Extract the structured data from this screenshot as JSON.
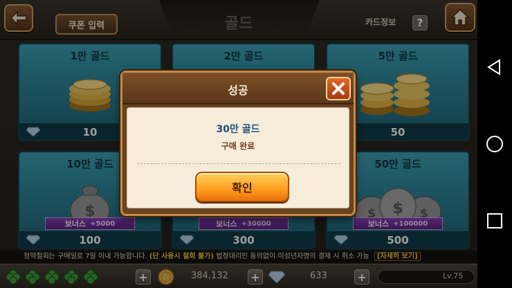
{
  "header": {
    "title": "골드",
    "coupon_button": "쿠폰 입력",
    "card_info_label": "카드정보",
    "help_symbol": "?"
  },
  "products": [
    {
      "title": "1만 골드",
      "price": "10",
      "bonus_label": "",
      "bonus_amount": "",
      "art": "coin-stack-small"
    },
    {
      "title": "2만 골드",
      "price": "",
      "bonus_label": "",
      "bonus_amount": "",
      "art": "coin-stack-medium"
    },
    {
      "title": "5만 골드",
      "price": "50",
      "bonus_label": "",
      "bonus_amount": "",
      "art": "coin-stack-large"
    },
    {
      "title": "10만 골드",
      "price": "100",
      "bonus_label": "보너스",
      "bonus_amount": "+5000",
      "art": "money-bag"
    },
    {
      "title": "",
      "price": "300",
      "bonus_label": "보너스",
      "bonus_amount": "+30000",
      "art": "money-bags"
    },
    {
      "title": "50만 골드",
      "price": "500",
      "bonus_label": "보너스",
      "bonus_amount": "+100000",
      "art": "money-bags-large"
    }
  ],
  "dialog": {
    "title": "성공",
    "item": "30만 골드",
    "message": "구매 완료",
    "confirm_button": "확인"
  },
  "notice": {
    "text_before": "청약철회는 구매일로 7일 이내 가능합니다.",
    "warning": "(단 사용시 철회 불가)",
    "text_after": "법정대리인 동의없이 미성년자명의 결제 시 취소 가능",
    "detail_button": "[자세히 보기]"
  },
  "resources": {
    "gold": "384,132",
    "gems": "633",
    "level": "Lv.75"
  },
  "colors": {
    "card_teal": "#3ca3b6",
    "confirm_orange": "#ff9c1e",
    "bonus_purple": "#8a3fb7"
  }
}
